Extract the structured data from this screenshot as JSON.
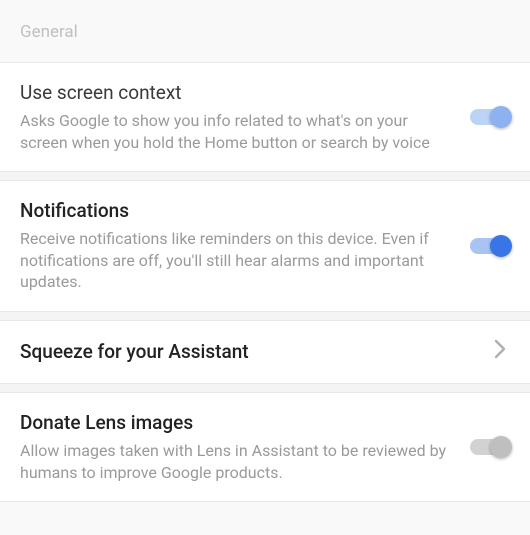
{
  "section_header": "General",
  "settings": {
    "screen_context": {
      "title": "Use screen context",
      "desc": "Asks Google to show you info related to what's on your screen when you hold the Home button or search by voice"
    },
    "notifications": {
      "title": "Notifications",
      "desc": "Receive notifications like reminders on this device. Even if notifications are off, you'll still hear alarms and important updates."
    },
    "squeeze": {
      "title": "Squeeze for your Assistant"
    },
    "donate_lens": {
      "title": "Donate Lens images",
      "desc": "Allow images taken with Lens in Assistant to be reviewed by humans to improve Google products."
    }
  }
}
